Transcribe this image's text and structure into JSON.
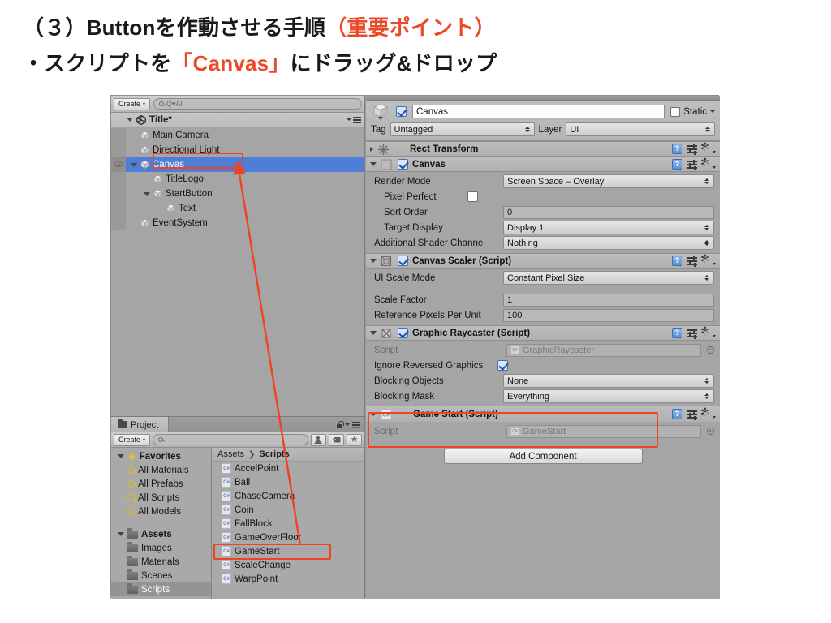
{
  "slide": {
    "line1_prefix": "（３）Buttonを作動させる手順",
    "line1_accent": "（重要ポイント）",
    "line2_a": "・スクリプトを",
    "line2_accent": "「Canvas」",
    "line2_b": "にドラッグ&ドロップ",
    "accent_color": "#ea4a28"
  },
  "hierarchy": {
    "create_button": "Create",
    "create_caret": "▾",
    "search_placeholder": "Q▾All",
    "scene_name": "Title*",
    "items": [
      {
        "label": "Main Camera",
        "depth": 1,
        "expandable": false,
        "selected": false
      },
      {
        "label": "Directional Light",
        "depth": 1,
        "expandable": false,
        "selected": false
      },
      {
        "label": "Canvas",
        "depth": 1,
        "expandable": true,
        "selected": true
      },
      {
        "label": "TitleLogo",
        "depth": 2,
        "expandable": false,
        "selected": false
      },
      {
        "label": "StartButton",
        "depth": 2,
        "expandable": true,
        "selected": false
      },
      {
        "label": "Text",
        "depth": 3,
        "expandable": false,
        "selected": false
      },
      {
        "label": "EventSystem",
        "depth": 1,
        "expandable": false,
        "selected": false
      }
    ]
  },
  "project": {
    "tab_label": "Project",
    "create_button": "Create",
    "create_caret": "▾",
    "search_placeholder": "",
    "breadcrumb": [
      "Assets",
      "Scripts"
    ],
    "breadcrumb_sep": "❯",
    "tree": [
      {
        "label": "Favorites",
        "type": "star",
        "bold": true,
        "expanded": true,
        "selected": false
      },
      {
        "label": "All Materials",
        "type": "search",
        "bold": false,
        "selected": false
      },
      {
        "label": "All Prefabs",
        "type": "search",
        "bold": false,
        "selected": false
      },
      {
        "label": "All Scripts",
        "type": "search",
        "bold": false,
        "selected": false
      },
      {
        "label": "All Models",
        "type": "search",
        "bold": false,
        "selected": false
      },
      {
        "label": "",
        "type": "gap",
        "bold": false,
        "selected": false
      },
      {
        "label": "Assets",
        "type": "folder",
        "bold": true,
        "expanded": true,
        "selected": false
      },
      {
        "label": "Images",
        "type": "folder",
        "bold": false,
        "selected": false
      },
      {
        "label": "Materials",
        "type": "folder",
        "bold": false,
        "selected": false
      },
      {
        "label": "Scenes",
        "type": "folder",
        "bold": false,
        "selected": false
      },
      {
        "label": "Scripts",
        "type": "folder",
        "bold": false,
        "selected": true
      }
    ],
    "assets": [
      {
        "label": "AccelPoint",
        "icon": "C#"
      },
      {
        "label": "Ball",
        "icon": "C#"
      },
      {
        "label": "ChaseCamera",
        "icon": "C#"
      },
      {
        "label": "Coin",
        "icon": "C#"
      },
      {
        "label": "FallBlock",
        "icon": "C#"
      },
      {
        "label": "GameOverFloor",
        "icon": "C#"
      },
      {
        "label": "GameStart",
        "icon": "C#",
        "highlighted": true
      },
      {
        "label": "ScaleChange",
        "icon": "C#"
      },
      {
        "label": "WarpPoint",
        "icon": "C#"
      }
    ]
  },
  "inspector": {
    "object_name": "Canvas",
    "static_label": "Static",
    "tag_label": "Tag",
    "tag_value": "Untagged",
    "layer_label": "Layer",
    "layer_value": "UI",
    "components": [
      {
        "title": "Rect Transform",
        "collapsed": true,
        "has_enable_checkbox": false,
        "icon": "rect-transform-icon",
        "fields": []
      },
      {
        "title": "Canvas",
        "collapsed": false,
        "has_enable_checkbox": true,
        "enabled": true,
        "icon": "canvas-icon",
        "fields": [
          {
            "label": "Render Mode",
            "type": "popup",
            "value": "Screen Space – Overlay",
            "indent": false
          },
          {
            "label": "Pixel Perfect",
            "type": "checkbox",
            "value": false,
            "indent": true
          },
          {
            "label": "Sort Order",
            "type": "text",
            "value": "0",
            "indent": true
          },
          {
            "label": "Target Display",
            "type": "popup",
            "value": "Display 1",
            "indent": true
          },
          {
            "label": "Additional Shader Channel",
            "type": "popup",
            "value": "Nothing",
            "indent": false
          }
        ]
      },
      {
        "title": "Canvas Scaler (Script)",
        "collapsed": false,
        "has_enable_checkbox": true,
        "enabled": true,
        "icon": "canvas-scaler-icon",
        "fields": [
          {
            "label": "UI Scale Mode",
            "type": "popup",
            "value": "Constant Pixel Size",
            "indent": false
          },
          {
            "label": "",
            "type": "gap",
            "value": "",
            "indent": false
          },
          {
            "label": "Scale Factor",
            "type": "text",
            "value": "1",
            "indent": false
          },
          {
            "label": "Reference Pixels Per Unit",
            "type": "text",
            "value": "100",
            "indent": false
          }
        ]
      },
      {
        "title": "Graphic Raycaster (Script)",
        "collapsed": false,
        "has_enable_checkbox": true,
        "enabled": true,
        "icon": "graphic-raycaster-icon",
        "fields": [
          {
            "label": "Script",
            "type": "object",
            "value": "GraphicRaycaster",
            "indent": false,
            "dim": true
          },
          {
            "label": "Ignore Reversed Graphics",
            "type": "checkbox",
            "value": true,
            "indent": false
          },
          {
            "label": "Blocking Objects",
            "type": "popup",
            "value": "None",
            "indent": false
          },
          {
            "label": "Blocking Mask",
            "type": "popup",
            "value": "Everything",
            "indent": false
          }
        ]
      },
      {
        "title": "Game Start (Script)",
        "collapsed": false,
        "has_enable_checkbox": false,
        "icon": "cs-script-icon",
        "highlighted": true,
        "fields": [
          {
            "label": "Script",
            "type": "object",
            "value": "GameStart",
            "indent": false,
            "dim": true
          }
        ]
      }
    ],
    "add_component_label": "Add Component"
  },
  "annotations": {
    "box_color": "#ef4323",
    "arrow_from": "GameStart asset in Project panel",
    "arrow_to": "Canvas object in Hierarchy"
  }
}
